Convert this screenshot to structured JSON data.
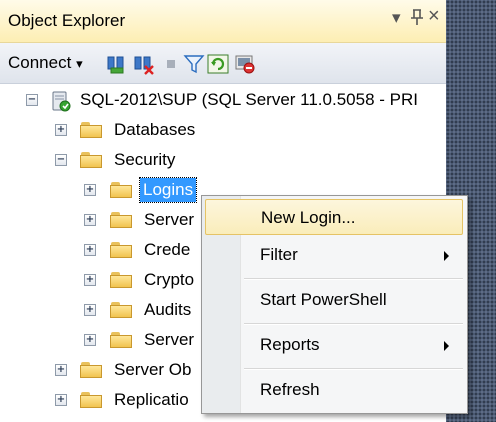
{
  "window": {
    "title": "Object Explorer",
    "controls": {
      "dropdown": "▾",
      "pin": "ᵖ",
      "close": "×"
    }
  },
  "toolbar": {
    "connect_label": "Connect",
    "connect_arrow": "▾",
    "buttons": [
      "connect-object-icon",
      "disconnect-icon",
      "stop-icon",
      "filter-icon",
      "refresh-icon",
      "activity-monitor-icon"
    ]
  },
  "tree": {
    "server": {
      "label": "SQL-2012\\SUP (SQL Server 11.0.5058 - PRI",
      "expander": "−"
    },
    "nodes": [
      {
        "label": "Databases",
        "expander": "+"
      },
      {
        "label": "Security",
        "expander": "−"
      },
      {
        "label": "Logins",
        "expander": "+",
        "selected": true
      },
      {
        "label": "Server",
        "expander": "+"
      },
      {
        "label": "Crede",
        "expander": "+"
      },
      {
        "label": "Crypto",
        "expander": "+"
      },
      {
        "label": "Audits",
        "expander": "+"
      },
      {
        "label": "Server",
        "expander": "+"
      },
      {
        "label": "Server Ob",
        "expander": "+"
      },
      {
        "label": "Replicatio",
        "expander": "+"
      }
    ]
  },
  "context_menu": {
    "items": [
      {
        "label": "New Login...",
        "highlighted": true,
        "submenu": false
      },
      {
        "label": "Filter",
        "submenu": true
      },
      {
        "label": "Start PowerShell",
        "submenu": false
      },
      {
        "label": "Reports",
        "submenu": true
      },
      {
        "label": "Refresh",
        "submenu": false
      }
    ]
  },
  "colors": {
    "selection": "#3399ff",
    "titlebar": "#fdeeb3",
    "menu_highlight": "#faedba",
    "ide_background": "#4b5a73"
  }
}
